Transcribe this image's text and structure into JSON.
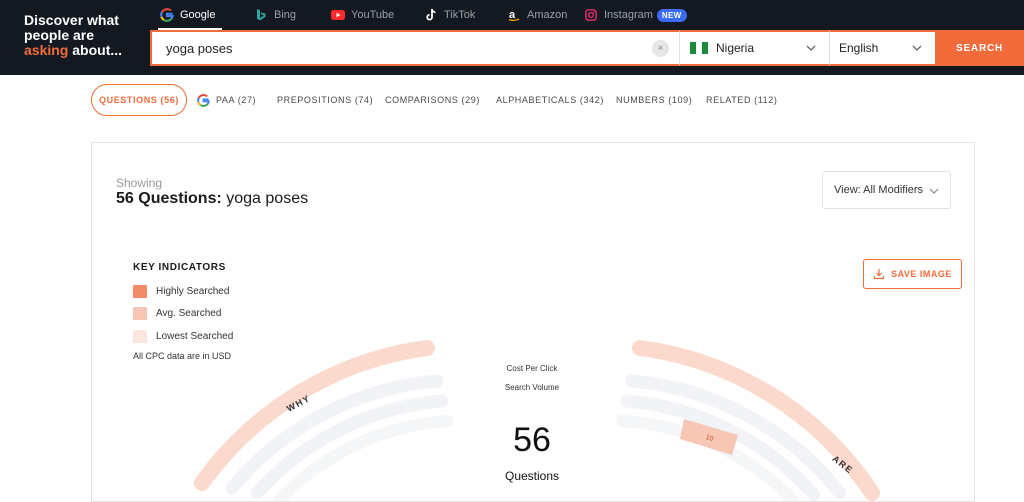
{
  "brand": {
    "line1": "Discover what",
    "line2": "people are",
    "line3_accent": "asking",
    "line3_rest": " about..."
  },
  "engines": [
    {
      "label": "Google",
      "icon": "google-icon",
      "active": true
    },
    {
      "label": "Bing",
      "icon": "bing-icon",
      "active": false
    },
    {
      "label": "YouTube",
      "icon": "youtube-icon",
      "active": false
    },
    {
      "label": "TikTok",
      "icon": "tiktok-icon",
      "active": false
    },
    {
      "label": "Amazon",
      "icon": "amazon-icon",
      "active": false
    },
    {
      "label": "Instagram",
      "icon": "instagram-icon",
      "active": false,
      "badge": "NEW"
    }
  ],
  "search": {
    "value": "yoga poses",
    "clear_symbol": "×",
    "country": "Nigeria",
    "language": "English",
    "button": "SEARCH"
  },
  "tabs": [
    {
      "label": "QUESTIONS (56)",
      "active": true
    },
    {
      "label": "PAA (27)",
      "active": false,
      "icon": "google-icon"
    },
    {
      "label": "PREPOSITIONS (74)",
      "active": false
    },
    {
      "label": "COMPARISONS (29)",
      "active": false
    },
    {
      "label": "ALPHABETICALS (342)",
      "active": false
    },
    {
      "label": "NUMBERS (109)",
      "active": false
    },
    {
      "label": "RELATED (112)",
      "active": false
    }
  ],
  "results": {
    "showing": "Showing",
    "title_bold": "56 Questions:",
    "title_rest": " yoga poses",
    "view_select": "View: All Modifiers"
  },
  "key": {
    "title": "KEY INDICATORS",
    "items": [
      {
        "label": "Highly Searched",
        "color": "#f28c68"
      },
      {
        "label": "Avg. Searched",
        "color": "#f8c6b4"
      },
      {
        "label": "Lowest Searched",
        "color": "#fde6de"
      }
    ],
    "note": "All CPC data are in USD"
  },
  "save_button": "SAVE IMAGE",
  "wheel": {
    "cpc_label": "Cost Per Click",
    "volume_label": "Search Volume",
    "count": "56",
    "count_label": "Questions",
    "segments": [
      "WHY",
      "ARE"
    ],
    "highlight_value": "10"
  },
  "colors": {
    "accent": "#f26b3a",
    "header_bg": "#141820",
    "badge_blue": "#3b6cf6"
  }
}
